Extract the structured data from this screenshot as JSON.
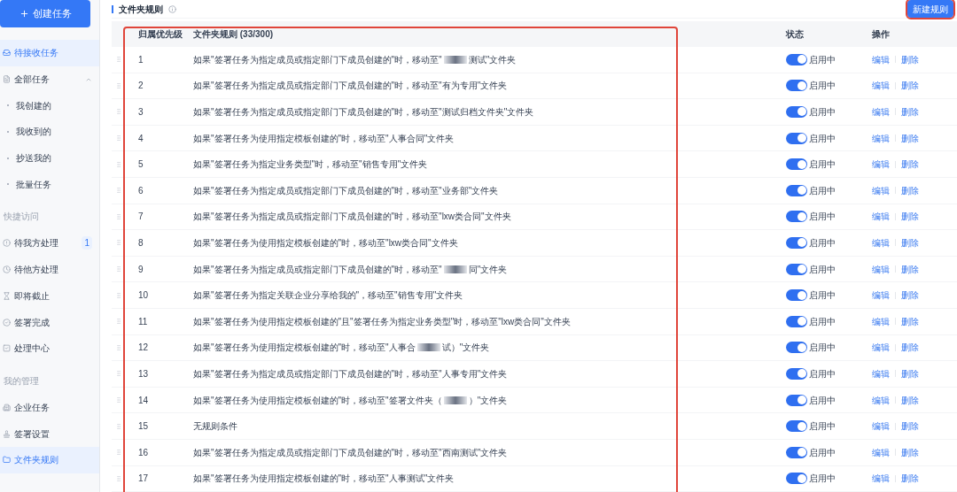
{
  "sidebar": {
    "create_button": "创建任务",
    "nav": [
      {
        "kind": "item",
        "label": "待接收任务",
        "selected": true
      },
      {
        "kind": "item",
        "label": "全部任务",
        "selected": false,
        "expanded": true
      },
      {
        "kind": "sub",
        "label": "我创建的",
        "selected": false
      },
      {
        "kind": "sub",
        "label": "我收到的",
        "selected": false
      },
      {
        "kind": "sub",
        "label": "抄送我的",
        "selected": false
      },
      {
        "kind": "sub",
        "label": "批量任务",
        "selected": false
      },
      {
        "kind": "section",
        "label": "快捷访问"
      },
      {
        "kind": "item",
        "label": "待我方处理",
        "selected": false,
        "badge": "1"
      },
      {
        "kind": "item",
        "label": "待他方处理",
        "selected": false
      },
      {
        "kind": "item",
        "label": "即将截止",
        "selected": false
      },
      {
        "kind": "item",
        "label": "签署完成",
        "selected": false
      },
      {
        "kind": "item",
        "label": "处理中心",
        "selected": false
      },
      {
        "kind": "section",
        "label": "我的管理"
      },
      {
        "kind": "item",
        "label": "企业任务",
        "selected": false
      },
      {
        "kind": "item",
        "label": "签署设置",
        "selected": false
      },
      {
        "kind": "item",
        "label": "文件夹规则",
        "selected": true
      }
    ]
  },
  "page": {
    "title": "文件夹规则",
    "new_button": "新建规则"
  },
  "table": {
    "columns": [
      "归属优先级",
      "文件夹规则 (33/300)",
      "状态",
      "操作"
    ],
    "rows": [
      {
        "priority": "1",
        "rule": "如果\"签署任务为指定成员或指定部门下成员创建的\"时，移动至\"",
        "rule_after": "测试\"文件夹",
        "on": true,
        "status": "启用中",
        "actions": [
          "编辑",
          "删除"
        ]
      },
      {
        "priority": "2",
        "rule": "如果\"签署任务为指定成员或指定部门下成员创建的\"时，移动至\"有为专用\"文件夹",
        "on": true,
        "status": "启用中",
        "actions": [
          "编辑",
          "删除"
        ]
      },
      {
        "priority": "3",
        "rule": "如果\"签署任务为指定成员或指定部门下成员创建的\"时，移动至\"测试归档文件夹\"文件夹",
        "on": true,
        "status": "启用中",
        "actions": [
          "编辑",
          "删除"
        ]
      },
      {
        "priority": "4",
        "rule": "如果\"签署任务为使用指定模板创建的\"时，移动至\"人事合同\"文件夹",
        "on": true,
        "status": "启用中",
        "actions": [
          "编辑",
          "删除"
        ]
      },
      {
        "priority": "5",
        "rule": "如果\"签署任务为指定业务类型\"时，移动至\"销售专用\"文件夹",
        "on": true,
        "status": "启用中",
        "actions": [
          "编辑",
          "删除"
        ]
      },
      {
        "priority": "6",
        "rule": "如果\"签署任务为指定成员或指定部门下成员创建的\"时，移动至\"业务部\"文件夹",
        "on": true,
        "status": "启用中",
        "actions": [
          "编辑",
          "删除"
        ]
      },
      {
        "priority": "7",
        "rule": "如果\"签署任务为指定成员或指定部门下成员创建的\"时，移动至\"lxw类合同\"文件夹",
        "on": true,
        "status": "启用中",
        "actions": [
          "编辑",
          "删除"
        ]
      },
      {
        "priority": "8",
        "rule": "如果\"签署任务为使用指定模板创建的\"时，移动至\"lxw类合同\"文件夹",
        "on": true,
        "status": "启用中",
        "actions": [
          "编辑",
          "删除"
        ]
      },
      {
        "priority": "9",
        "rule": "如果\"签署任务为指定成员或指定部门下成员创建的\"时，移动至\"",
        "rule_after": "同\"文件夹",
        "on": true,
        "status": "启用中",
        "actions": [
          "编辑",
          "删除"
        ]
      },
      {
        "priority": "10",
        "rule": "如果\"签署任务为指定关联企业分享给我的\"，移动至\"销售专用\"文件夹",
        "on": true,
        "status": "启用中",
        "actions": [
          "编辑",
          "删除"
        ]
      },
      {
        "priority": "11",
        "rule": "如果\"签署任务为使用指定模板创建的\"且\"签署任务为指定业务类型\"时，移动至\"lxw类合同\"文件夹",
        "on": true,
        "status": "启用中",
        "actions": [
          "编辑",
          "删除"
        ]
      },
      {
        "priority": "12",
        "rule": "如果\"签署任务为使用指定模板创建的\"时，移动至\"人事合",
        "rule_after": "试）\"文件夹",
        "on": true,
        "status": "启用中",
        "actions": [
          "编辑",
          "删除"
        ]
      },
      {
        "priority": "13",
        "rule": "如果\"签署任务为指定成员或指定部门下成员创建的\"时，移动至\"人事专用\"文件夹",
        "on": true,
        "status": "启用中",
        "actions": [
          "编辑",
          "删除"
        ]
      },
      {
        "priority": "14",
        "rule": "如果\"签署任务为使用指定模板创建的\"时，移动至\"签署文件夹（",
        "rule_after": "）\"文件夹",
        "on": true,
        "status": "启用中",
        "actions": [
          "编辑",
          "删除"
        ]
      },
      {
        "priority": "15",
        "rule": "无规则条件",
        "on": true,
        "status": "启用中",
        "actions": [
          "编辑",
          "删除"
        ]
      },
      {
        "priority": "16",
        "rule": "如果\"签署任务为指定成员或指定部门下成员创建的\"时，移动至\"西南测试\"文件夹",
        "on": true,
        "status": "启用中",
        "actions": [
          "编辑",
          "删除"
        ]
      },
      {
        "priority": "17",
        "rule": "如果\"签署任务为使用指定模板创建的\"时，移动至\"人事测试\"文件夹",
        "on": true,
        "status": "启用中",
        "actions": [
          "编辑",
          "删除"
        ]
      }
    ]
  }
}
